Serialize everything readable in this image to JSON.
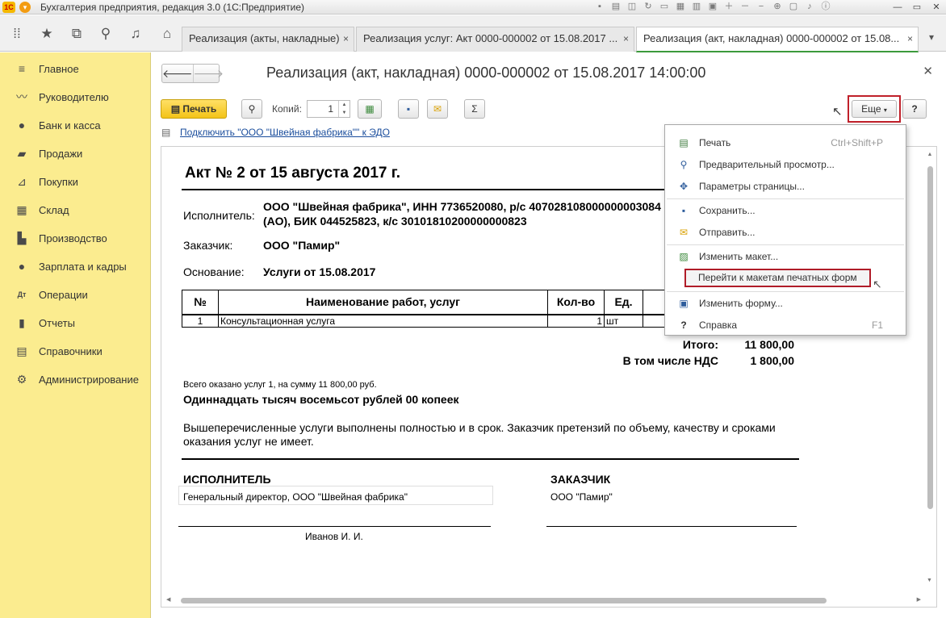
{
  "app": {
    "title": "Бухгалтерия предприятия, редакция 3.0  (1С:Предприятие)",
    "logo_text": "1С"
  },
  "tabs": [
    {
      "label": "Реализация (акты, накладные)"
    },
    {
      "label": "Реализация услуг: Акт 0000-000002 от 15.08.2017 ..."
    },
    {
      "label": "Реализация (акт, накладная) 0000-000002 от 15.08..."
    }
  ],
  "tab_close": "×",
  "sidebar": {
    "items": [
      {
        "label": "Главное",
        "icon": "menu-lines-icon"
      },
      {
        "label": "Руководителю",
        "icon": "trend-icon"
      },
      {
        "label": "Банк и касса",
        "icon": "coin-icon"
      },
      {
        "label": "Продажи",
        "icon": "briefcase-icon"
      },
      {
        "label": "Покупки",
        "icon": "cart-icon"
      },
      {
        "label": "Склад",
        "icon": "warehouse-icon"
      },
      {
        "label": "Производство",
        "icon": "factory-icon"
      },
      {
        "label": "Зарплата и кадры",
        "icon": "person-icon"
      },
      {
        "label": "Операции",
        "icon": "dt-kt-icon"
      },
      {
        "label": "Отчеты",
        "icon": "bar-chart-icon"
      },
      {
        "label": "Справочники",
        "icon": "book-icon"
      },
      {
        "label": "Администрирование",
        "icon": "gear-icon"
      }
    ]
  },
  "form": {
    "title": "Реализация (акт, накладная) 0000-000002 от 15.08.2017 14:00:00",
    "print_label": "Печать",
    "copies_label": "Копий:",
    "copies_value": "1",
    "more_label": "Еще",
    "help_label": "?",
    "edo_link": "Подключить \"ООО \"Швейная фабрика\"\" к ЭДО"
  },
  "document": {
    "title": "Акт № 2 от 15 августа 2017 г.",
    "executor_label": "Исполнитель:",
    "executor_line1": "ООО \"Швейная фабрика\", ИНН 7736520080, р/с 407028108000000003084",
    "executor_line2": "(АО), БИК 044525823, к/с 30101810200000000823",
    "customer_label": "Заказчик:",
    "customer_value": "ООО \"Памир\"",
    "basis_label": "Основание:",
    "basis_value": "Услуги от 15.08.2017",
    "table_headers": [
      "№",
      "Наименование работ, услуг",
      "Кол-во",
      "Ед.",
      ""
    ],
    "rows": [
      {
        "num": "1",
        "name": "Консультационная услуга",
        "qty": "1",
        "unit": "шт",
        "rest": ""
      }
    ],
    "total_label": "Итого:",
    "total_value": "11 800,00",
    "vat_label": "В том числе НДС",
    "vat_value": "1 800,00",
    "summary_small": "Всего оказано услуг 1, на сумму 11 800,00 руб.",
    "amount_words": "Одиннадцать тысяч восемьсот рублей 00 копеек",
    "paragraph": "Вышеперечисленные услуги выполнены полностью и в срок. Заказчик претензий по объему, качеству и сроками оказания услуг не имеет.",
    "sig_executor_head": "ИСПОЛНИТЕЛЬ",
    "sig_executor_position": "Генеральный директор, ООО \"Швейная фабрика\"",
    "sig_customer_head": "ЗАКАЗЧИК",
    "sig_customer_org": "ООО \"Памир\"",
    "sig_name": "Иванов И. И."
  },
  "dropdown": {
    "items": [
      {
        "label": "Печать",
        "shortcut": "Ctrl+Shift+P",
        "icon": "printer-icon"
      },
      {
        "label": "Предварительный просмотр...",
        "icon": "preview-icon"
      },
      {
        "label": "Параметры страницы...",
        "icon": "page-settings-icon"
      },
      {
        "label": "Сохранить...",
        "icon": "save-icon"
      },
      {
        "label": "Отправить...",
        "icon": "envelope-icon"
      },
      {
        "label": "Изменить макет...",
        "icon": "edit-template-icon"
      },
      {
        "label": "Перейти к макетам печатных форм",
        "icon": ""
      },
      {
        "label": "Изменить форму...",
        "icon": "edit-form-icon"
      },
      {
        "label": "Справка",
        "shortcut": "F1",
        "icon": "help-icon"
      }
    ]
  }
}
